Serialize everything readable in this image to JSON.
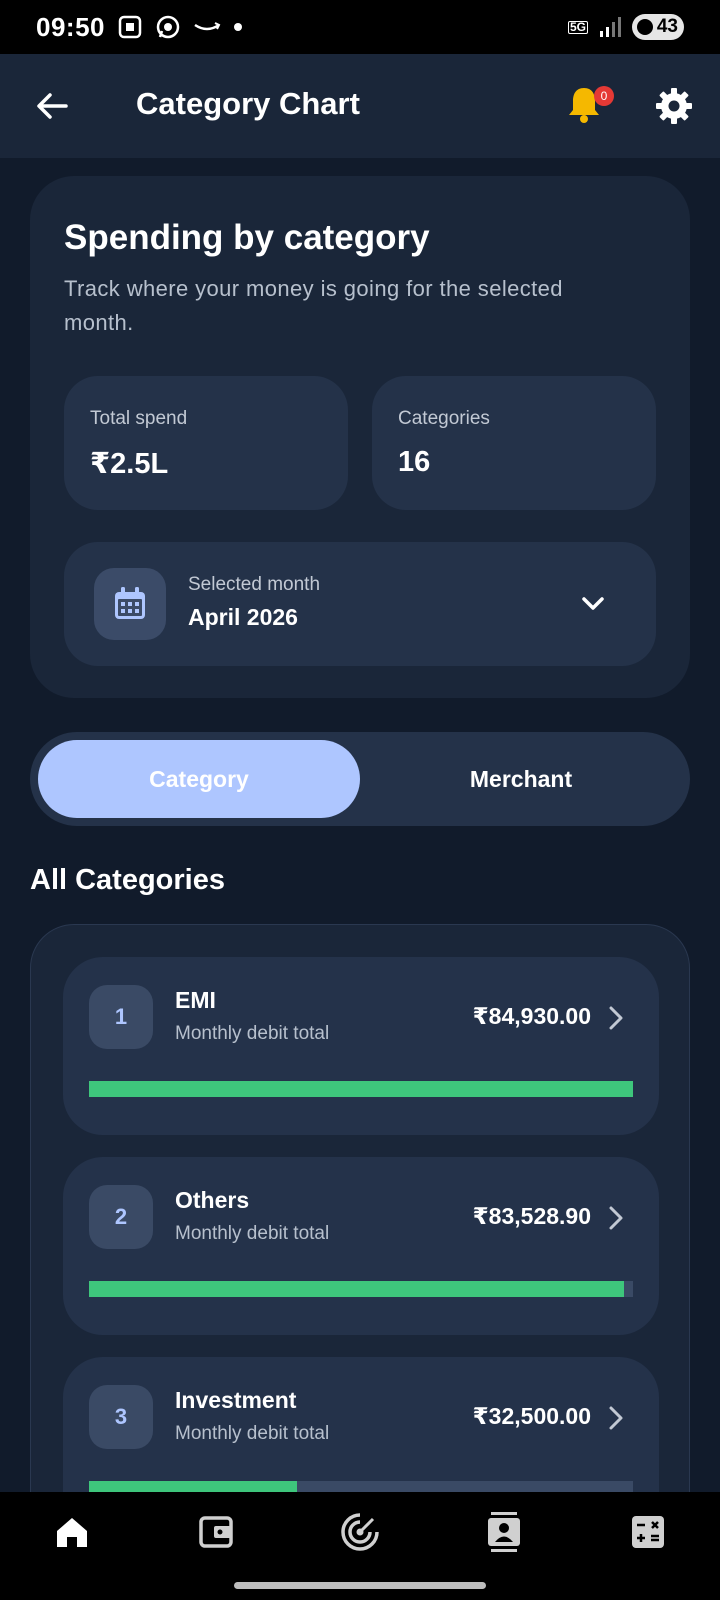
{
  "status_bar": {
    "time": "09:50",
    "network": "5G",
    "battery": "43"
  },
  "header": {
    "title": "Category Chart",
    "notification_count": "0"
  },
  "summary": {
    "title": "Spending by category",
    "subtitle": "Track where your money is going for the selected month.",
    "total_spend_label": "Total spend",
    "total_spend_value": "₹2.5L",
    "categories_label": "Categories",
    "categories_value": "16",
    "month_label": "Selected month",
    "month_value": "April 2026"
  },
  "toggle": {
    "options": [
      "Category",
      "Merchant"
    ],
    "active": "Category"
  },
  "section_title": "All Categories",
  "categories": [
    {
      "rank": "1",
      "name": "EMI",
      "subtitle": "Monthly debit total",
      "amount": "₹84,930.00",
      "share": 1.0
    },
    {
      "rank": "2",
      "name": "Others",
      "subtitle": "Monthly debit total",
      "amount": "₹83,528.90",
      "share": 0.983
    },
    {
      "rank": "3",
      "name": "Investment",
      "subtitle": "Monthly debit total",
      "amount": "₹32,500.00",
      "share": 0.383
    }
  ],
  "bottom_nav": [
    "home-icon",
    "wallet-icon",
    "radar-icon",
    "contacts-icon",
    "calculator-icon"
  ],
  "colors": {
    "background": "#111b2b",
    "card": "#1a2639",
    "accent": "#aec6ff",
    "bar_fill": "#3ec67c",
    "bell": "#f5b800",
    "badge": "#e53935"
  }
}
